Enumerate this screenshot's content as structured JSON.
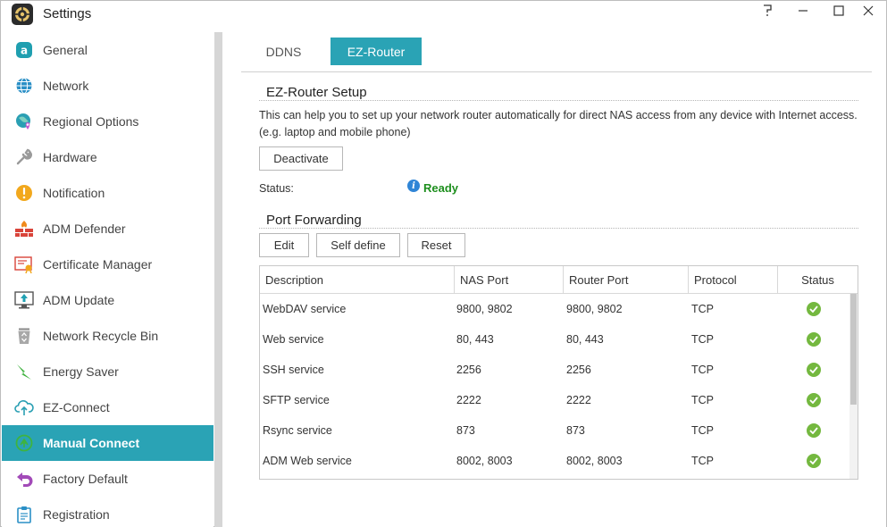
{
  "window": {
    "title": "Settings"
  },
  "sidebar": {
    "items": [
      {
        "label": "General",
        "icon": "general-icon"
      },
      {
        "label": "Network",
        "icon": "globe-icon"
      },
      {
        "label": "Regional Options",
        "icon": "regional-icon"
      },
      {
        "label": "Hardware",
        "icon": "hardware-icon"
      },
      {
        "label": "Notification",
        "icon": "notification-icon"
      },
      {
        "label": "ADM Defender",
        "icon": "firewall-icon"
      },
      {
        "label": "Certificate Manager",
        "icon": "certificate-icon"
      },
      {
        "label": "ADM Update",
        "icon": "update-icon"
      },
      {
        "label": "Network Recycle Bin",
        "icon": "recycle-bin-icon"
      },
      {
        "label": "Energy Saver",
        "icon": "energy-icon"
      },
      {
        "label": "EZ-Connect",
        "icon": "cloud-icon"
      },
      {
        "label": "Manual Connect",
        "icon": "manual-connect-icon"
      },
      {
        "label": "Factory Default",
        "icon": "undo-icon"
      },
      {
        "label": "Registration",
        "icon": "clipboard-icon"
      }
    ],
    "active": "Manual Connect"
  },
  "tabs": [
    {
      "label": "DDNS"
    },
    {
      "label": "EZ-Router"
    }
  ],
  "active_tab": "EZ-Router",
  "setup": {
    "title": "EZ-Router Setup",
    "description": "This can help you to set up your network router automatically for direct NAS access from any device with Internet access. (e.g. laptop and mobile phone)",
    "deactivate_label": "Deactivate",
    "status_label": "Status:",
    "status_value": "Ready"
  },
  "port_forwarding": {
    "title": "Port Forwarding",
    "edit_label": "Edit",
    "self_define_label": "Self define",
    "reset_label": "Reset",
    "columns": [
      "Description",
      "NAS Port",
      "Router Port",
      "Protocol",
      "Status"
    ],
    "rows": [
      [
        "WebDAV service",
        "9800, 9802",
        "9800, 9802",
        "TCP"
      ],
      [
        "Web service",
        "80, 443",
        "80, 443",
        "TCP"
      ],
      [
        "SSH service",
        "2256",
        "2256",
        "TCP"
      ],
      [
        "SFTP service",
        "2222",
        "2222",
        "TCP"
      ],
      [
        "Rsync service",
        "873",
        "873",
        "TCP"
      ],
      [
        "ADM Web service",
        "8002, 8003",
        "8002, 8003",
        "TCP"
      ]
    ]
  },
  "colors": {
    "accent": "#2aa3b5",
    "ready": "#1e8f1e",
    "ok": "#74b83f"
  }
}
